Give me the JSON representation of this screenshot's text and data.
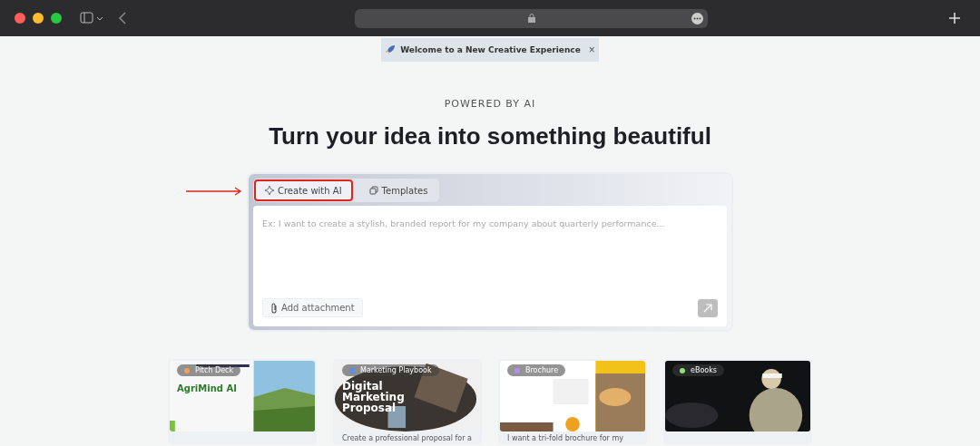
{
  "banner": {
    "text": "Welcome to a New Creative Experience",
    "close": "×"
  },
  "eyebrow": "POWERED BY AI",
  "heading": "Turn your idea into something beautiful",
  "tabs": [
    {
      "label": "Create with AI",
      "selected": true,
      "highlighted": true
    },
    {
      "label": "Templates",
      "selected": false,
      "highlighted": false
    }
  ],
  "prompt": {
    "placeholder": "Ex: I want to create a stylish, branded report for my company about quarterly performance...",
    "attachment": "Add attachment"
  },
  "cards": [
    {
      "tag": "Pitch Deck",
      "color": "#f59e5b",
      "thumb_title": "AgriMind AI"
    },
    {
      "tag": "Marketing Playbook",
      "color": "#5b8def",
      "thumb_title": "Digital Marketing Proposal",
      "caption": "Create a professional proposal for a"
    },
    {
      "tag": "Brochure",
      "color": "#b58cf0",
      "caption": "I want a tri-fold brochure for my"
    },
    {
      "tag": "eBooks",
      "color": "#8ee07a"
    }
  ]
}
